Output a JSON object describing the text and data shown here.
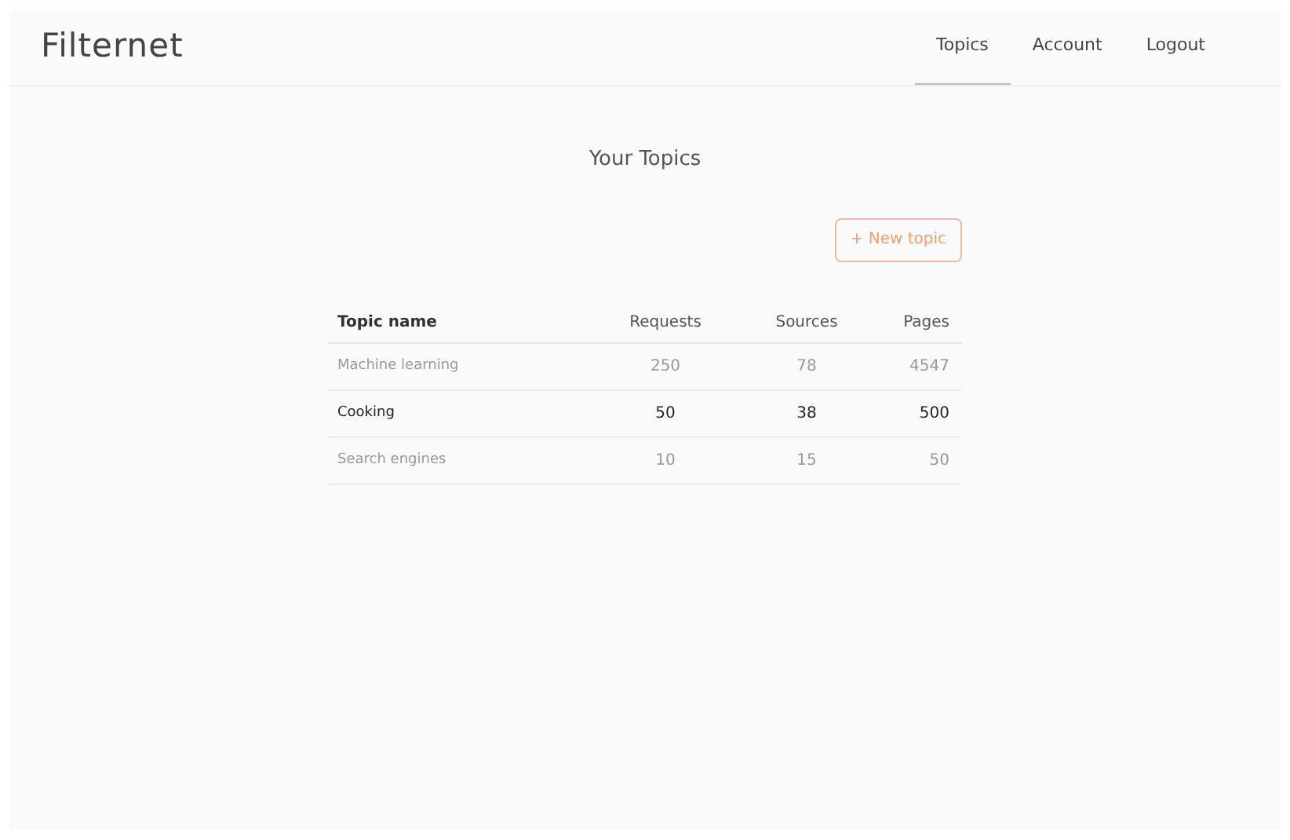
{
  "brand": "Filternet",
  "nav": [
    {
      "label": "Topics",
      "selected": true
    },
    {
      "label": "Account",
      "selected": false
    },
    {
      "label": "Logout",
      "selected": false
    }
  ],
  "heading": "Your Topics",
  "new_button": "+ New topic",
  "table": {
    "columns": [
      "Topic name",
      "Requests",
      "Sources",
      "Pages"
    ],
    "rows": [
      {
        "cells": [
          "Machine learning",
          "250",
          "78",
          "4547"
        ],
        "highlighted": false
      },
      {
        "cells": [
          "Cooking",
          "50",
          "38",
          "500"
        ],
        "highlighted": true
      },
      {
        "cells": [
          "Search engines",
          "10",
          "15",
          "50"
        ],
        "highlighted": false
      }
    ]
  }
}
